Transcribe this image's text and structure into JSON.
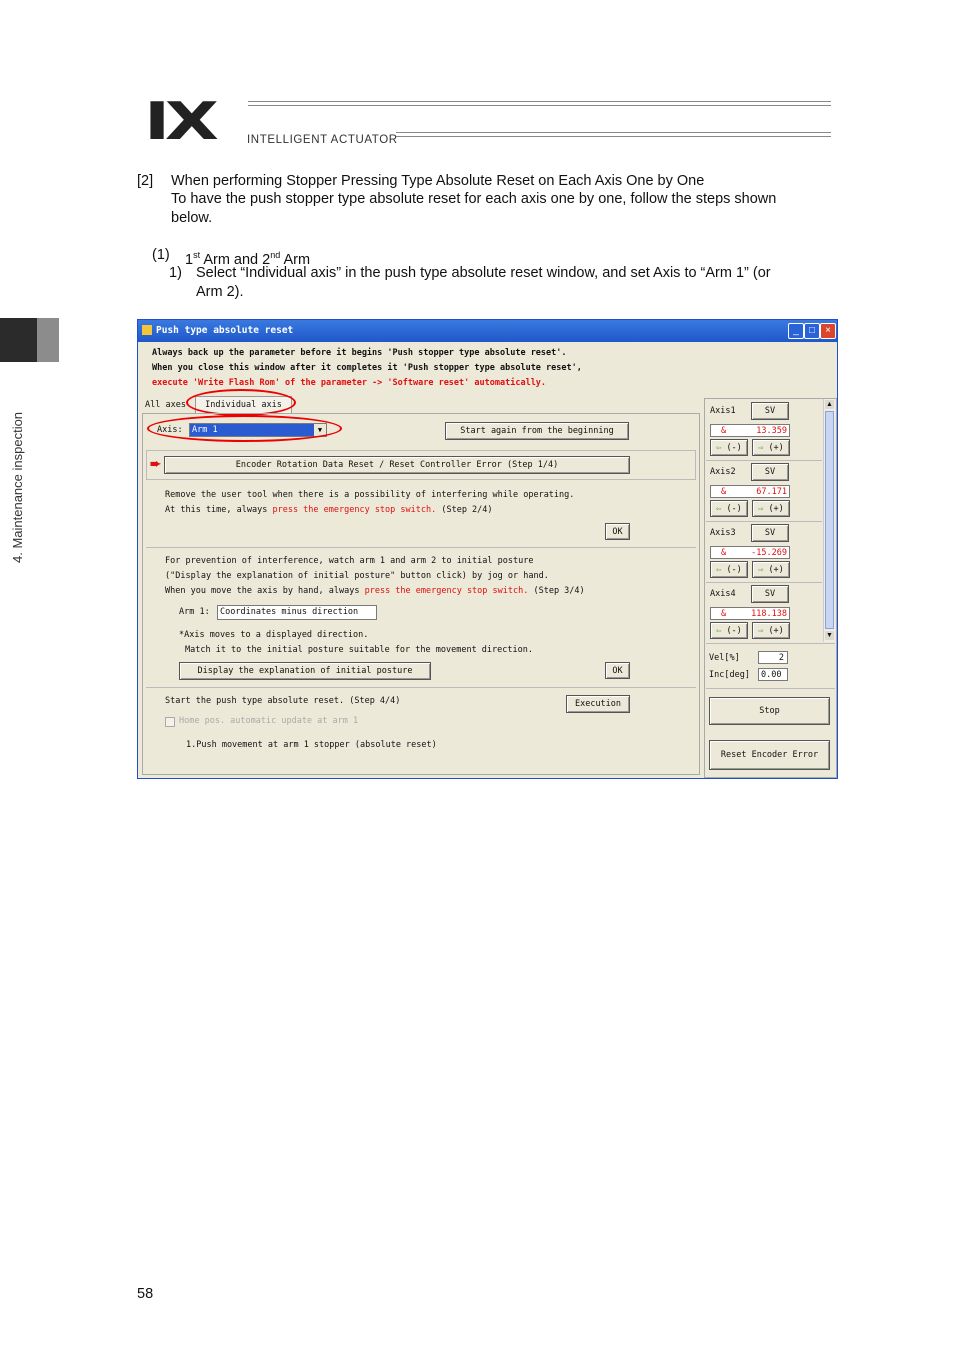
{
  "header": {
    "logo": "IX",
    "logo_sub": "INTELLIGENT ACTUATOR"
  },
  "side_label": "4. Maintenance inspection",
  "text": {
    "s2_num": "[2]",
    "s2_title": "When performing Stopper Pressing Type Absolute Reset on Each Axis One by One",
    "s2_body1": "To have the push stopper type absolute reset for each axis one by one, follow the steps shown",
    "s2_body2": "below.",
    "sub1_num": "(1)",
    "sub1_a": "1",
    "sub1_sup1": "st",
    "sub1_b": " Arm and 2",
    "sub1_sup2": "nd",
    "sub1_c": " Arm",
    "step1_num": "1)",
    "step1_l1": "Select “Individual axis” in the push type absolute reset window, and set Axis to “Arm 1” (or",
    "step1_l2": "Arm 2)."
  },
  "window": {
    "title": "Push type absolute reset",
    "warn1": "Always back up the parameter before it begins 'Push stopper type absolute reset'.",
    "warn2": "When you close this window after it completes it 'Push stopper type absolute reset',",
    "warn3": "execute 'Write Flash Rom' of the parameter -> 'Software reset' automatically.",
    "tabs": [
      "All axes",
      "Individual axis"
    ],
    "axis_label": "Axis:",
    "axis_value": "Arm 1",
    "start_again": "Start again from the beginning",
    "encoder_btn": "Encoder Rotation Data Reset / Reset Controller Error (Step 1/4)",
    "step2_l1": "Remove the user tool when there is a possibility of interfering while operating.",
    "step2_l2a": "At this time, always ",
    "step2_l2b": "press the emergency stop switch.",
    "step2_l2c": " (Step 2/4)",
    "ok": "OK",
    "step3_l1": "For prevention of interference, watch arm 1 and arm 2 to initial posture",
    "step3_l2": "(\"Display the explanation of initial posture\" button click) by jog or hand.",
    "step3_l3a": "When you move the axis by hand, always ",
    "step3_l3b": "press the emergency stop switch.",
    "step3_l3c": " (Step 3/4)",
    "arm_label": "Arm 1:",
    "arm_dir": "Coordinates minus direction",
    "note1": "*Axis moves to a displayed direction.",
    "note2": "Match it to the initial posture suitable for the movement direction.",
    "display_btn": "Display the explanation of initial posture",
    "step4": "Start the push type absolute reset. (Step 4/4)",
    "execution": "Execution",
    "home_chk": "Home pos. automatic update at arm 1",
    "push_move": "1.Push movement at arm 1 stopper (absolute reset)",
    "axes": [
      {
        "name": "Axis1",
        "sv": "SV",
        "unit": "&",
        "value": "13.359"
      },
      {
        "name": "Axis2",
        "sv": "SV",
        "unit": "&",
        "value": "67.171"
      },
      {
        "name": "Axis3",
        "sv": "SV",
        "unit": "&",
        "value": "-15.269"
      },
      {
        "name": "Axis4",
        "sv": "SV",
        "unit": "&",
        "value": "118.138"
      }
    ],
    "jog_minus": "(-)",
    "jog_plus": "(+)",
    "vel_label": "Vel[%]",
    "vel_value": "2",
    "inc_label": "Inc[deg]",
    "inc_value": "0.00",
    "stop": "Stop",
    "reset_encoder": "Reset Encoder Error"
  },
  "page_number": "58"
}
